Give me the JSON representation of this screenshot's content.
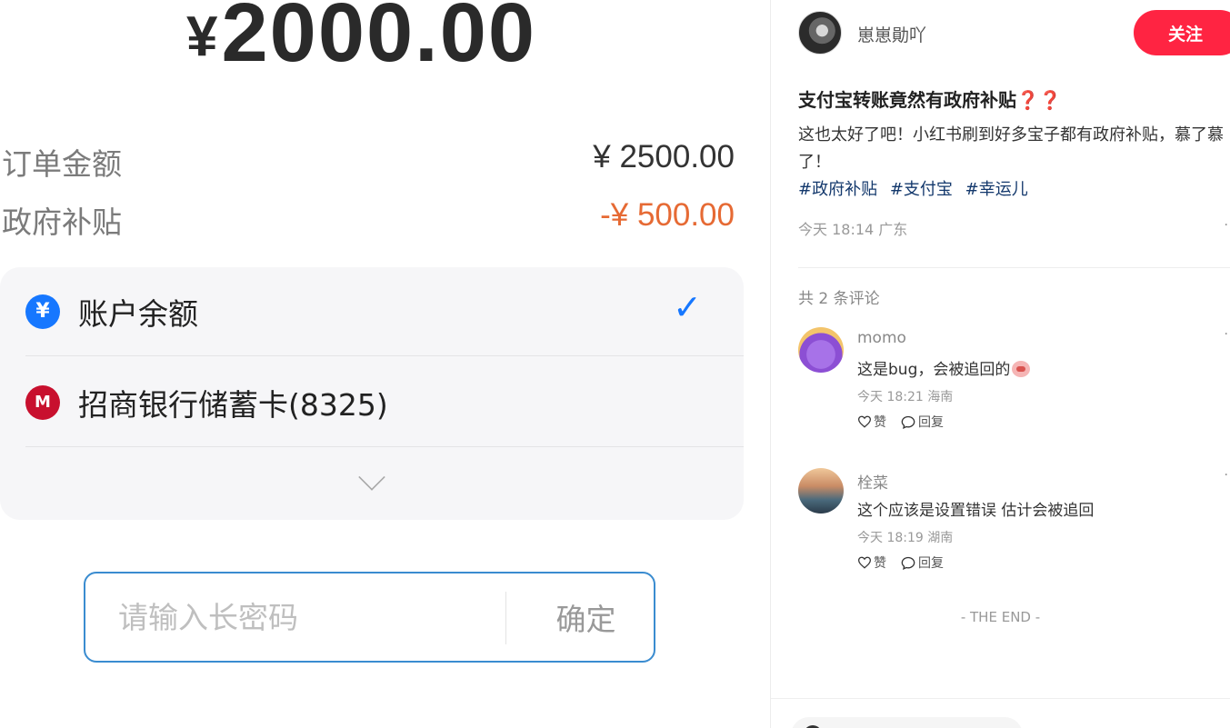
{
  "payment": {
    "amount_currency": "¥",
    "amount_value": "2000.00",
    "order_label": "订单金额",
    "order_value": "¥ 2500.00",
    "subsidy_label": "政府补贴",
    "subsidy_value": "-¥ 500.00",
    "methods": [
      {
        "label": "账户余额",
        "icon": "yuan-circle-icon",
        "selected": true
      },
      {
        "label": "招商银行储蓄卡(8325)",
        "icon": "cmb-bank-icon",
        "selected": false
      }
    ],
    "password_placeholder": "请输入长密码",
    "confirm_label": "确定",
    "colors": {
      "subsidy": "#e66a34",
      "accent": "#1677ff",
      "input_border": "#3a8cd0"
    }
  },
  "note": {
    "author_name": "崽崽勛吖",
    "follow_label": "关注",
    "title": "支付宝转账竟然有政府补贴",
    "title_icons": [
      "red-question-icon",
      "red-question-icon"
    ],
    "body": "这也太好了吧！小红书刷到好多宝子都有政府补贴，慕了慕了！",
    "tags": [
      "#政府补贴",
      "#支付宝",
      "#幸运儿"
    ],
    "meta": "今天 18:14 广东",
    "comment_count": "共 2 条评论",
    "comments": [
      {
        "name": "momo",
        "text": "这是bug，会被追回的",
        "meta": "今天 18:21 海南",
        "like": "赞",
        "reply": "回复"
      },
      {
        "name": "栓菜",
        "text": "这个应该是设置错误 估计会被追回",
        "meta": "今天 18:19 湖南",
        "like": "赞",
        "reply": "回复"
      }
    ],
    "end_text": "- THE END -",
    "colors": {
      "follow": "#ff2442",
      "tag": "#13386c"
    }
  }
}
